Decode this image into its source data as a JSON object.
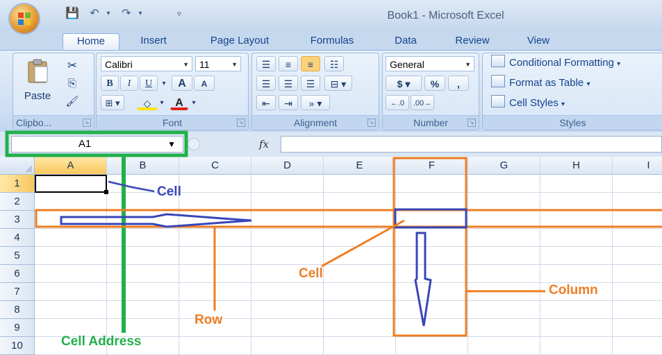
{
  "window": {
    "title": "Book1 - Microsoft Excel"
  },
  "tabs": [
    {
      "label": "Home",
      "active": true
    },
    {
      "label": "Insert"
    },
    {
      "label": "Page Layout"
    },
    {
      "label": "Formulas"
    },
    {
      "label": "Data"
    },
    {
      "label": "Review"
    },
    {
      "label": "View"
    }
  ],
  "ribbon": {
    "clipboard": {
      "label": "Clipbo...",
      "paste": "Paste"
    },
    "font": {
      "label": "Font",
      "font_name": "Calibri",
      "font_size": "11",
      "bold": "B",
      "italic": "I",
      "underline": "U",
      "grow": "A",
      "shrink": "A",
      "font_color_letter": "A"
    },
    "alignment": {
      "label": "Alignment"
    },
    "number": {
      "label": "Number",
      "format": "General",
      "currency": "$",
      "percent": "%",
      "comma": ","
    },
    "styles": {
      "label": "Styles",
      "items": [
        "Conditional Formatting",
        "Format as Table",
        "Cell Styles"
      ]
    }
  },
  "formula_bar": {
    "name_box": "A1",
    "fx": "fx",
    "value": ""
  },
  "grid": {
    "columns": [
      "A",
      "B",
      "C",
      "D",
      "E",
      "F",
      "G",
      "H",
      "I"
    ],
    "rows": [
      "1",
      "2",
      "3",
      "4",
      "5",
      "6",
      "7",
      "8",
      "9",
      "10"
    ],
    "active_cell": "A1"
  },
  "annotations": {
    "cell_top": "Cell",
    "cell_mid": "Cell",
    "row": "Row",
    "column": "Column",
    "cell_address": "Cell Address"
  },
  "colors": {
    "orange": "#ef7d22",
    "blue": "#3846b8",
    "green": "#22b04a"
  }
}
